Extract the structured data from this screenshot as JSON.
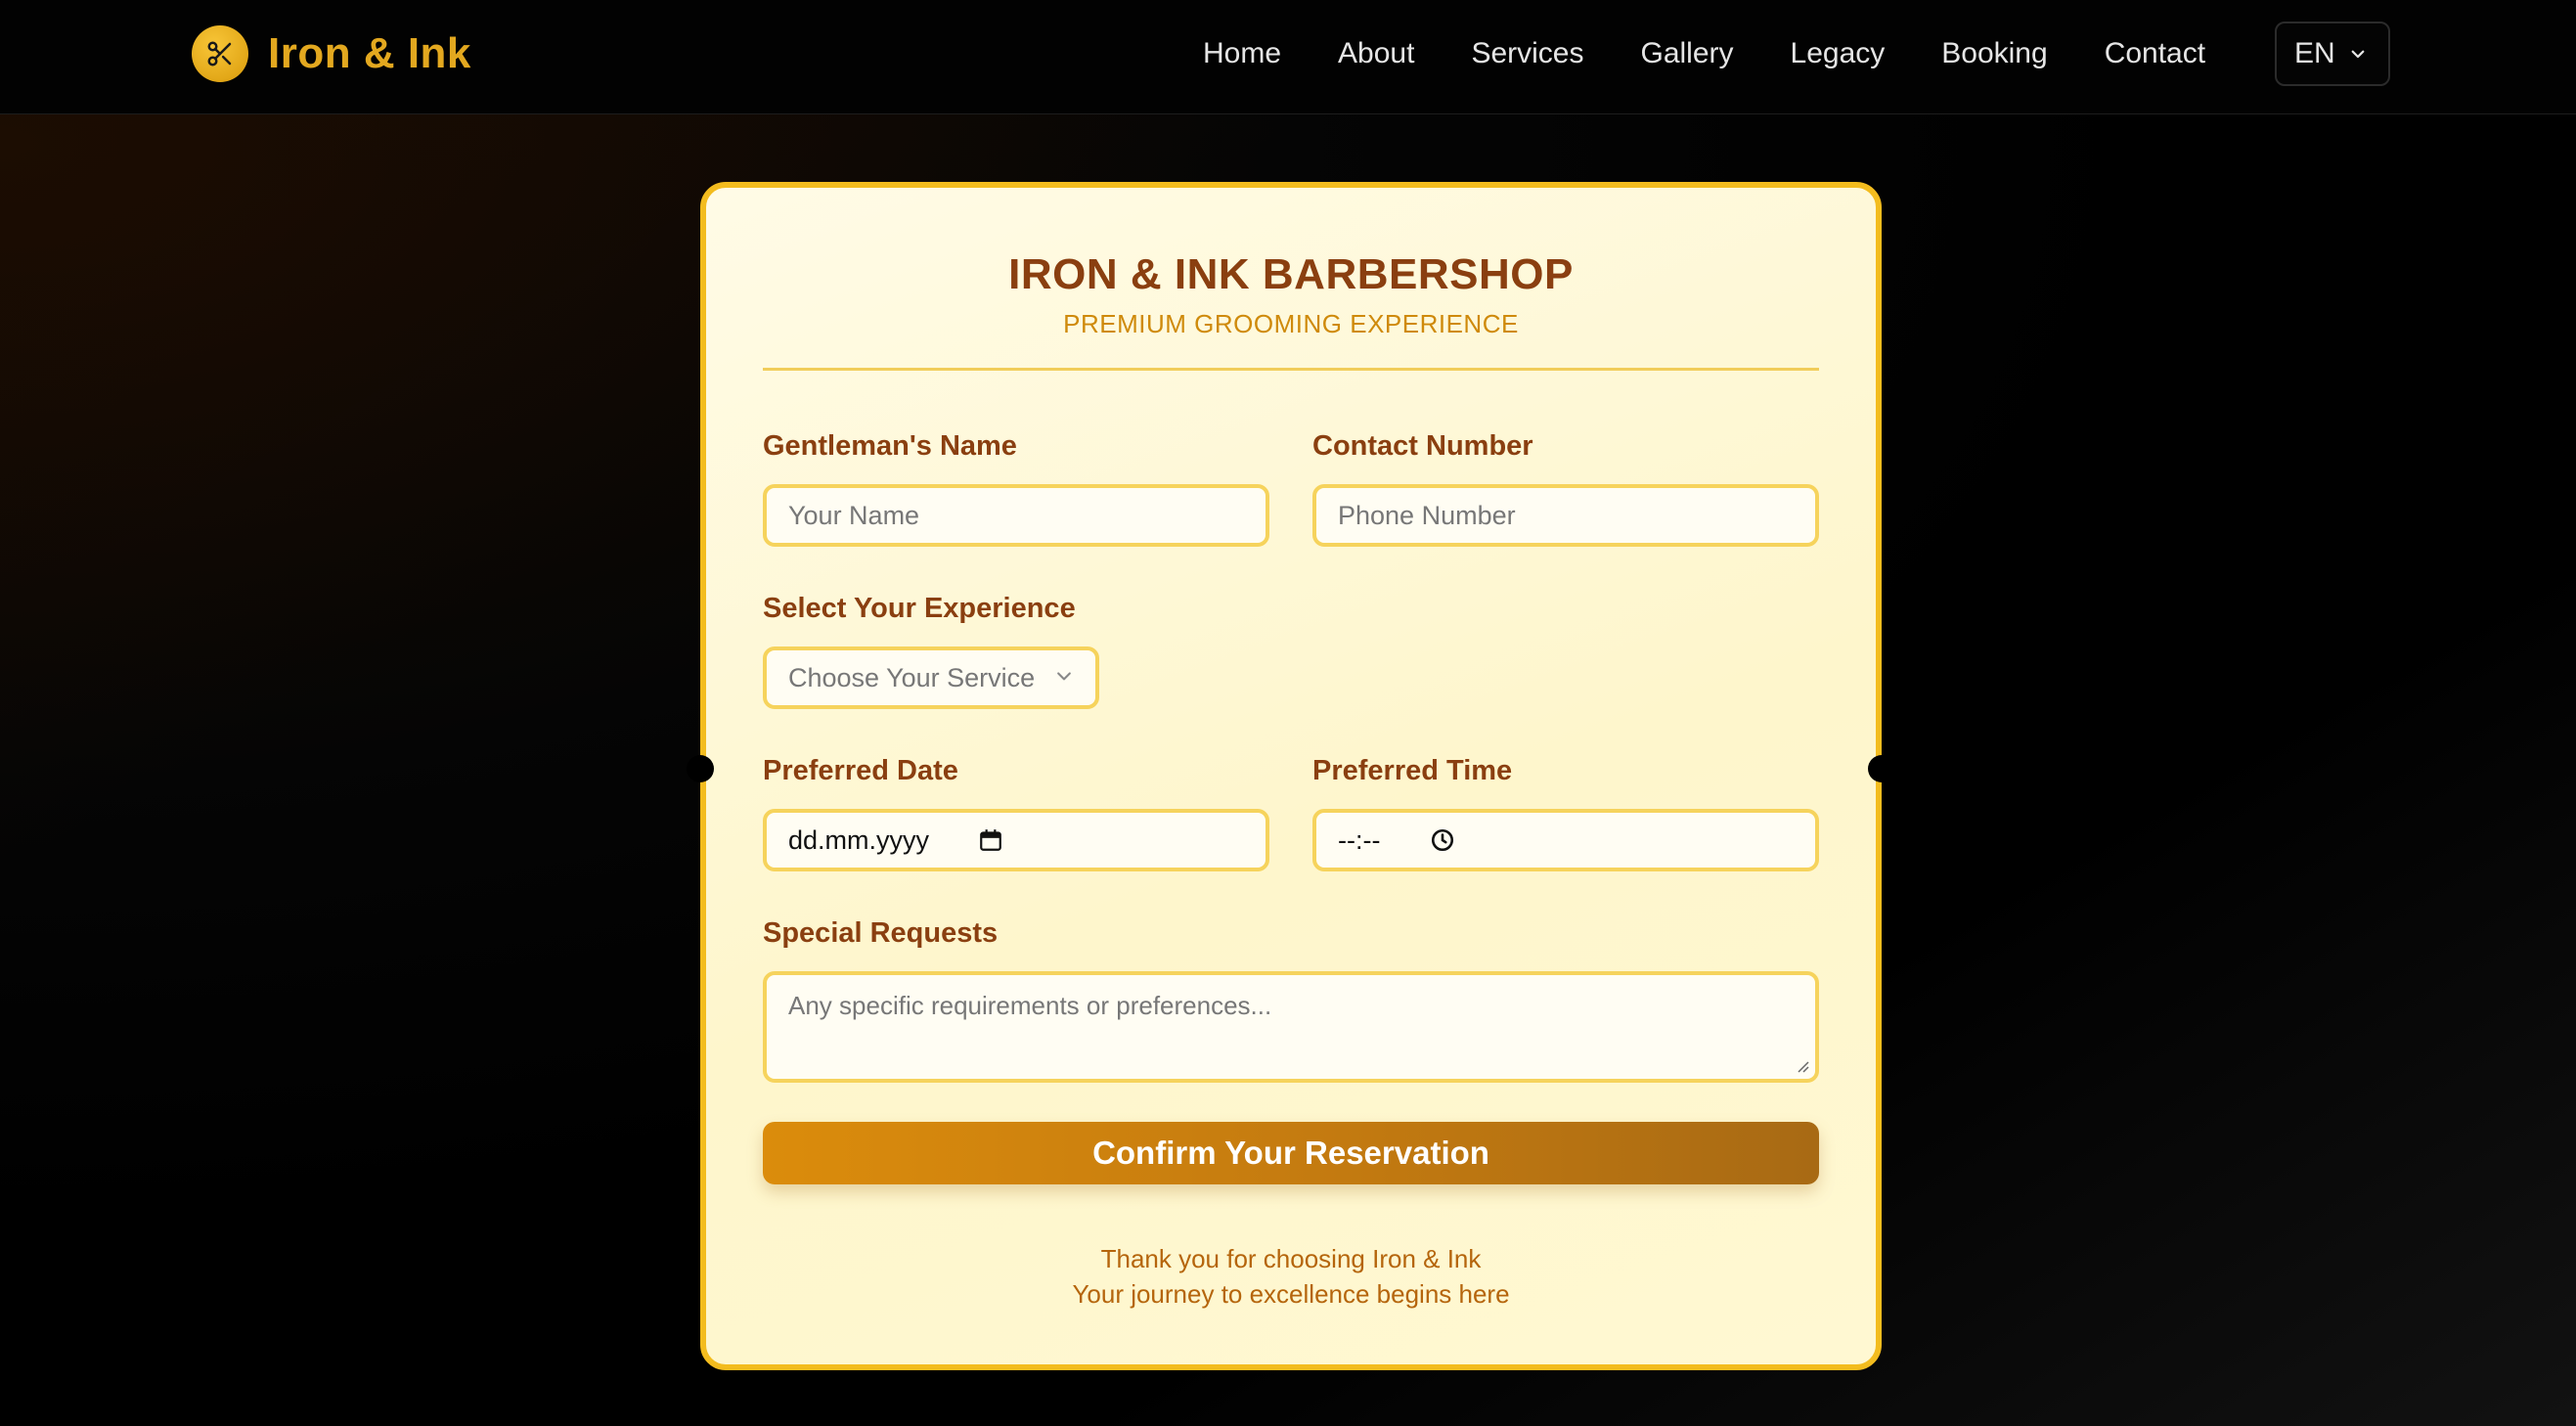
{
  "header": {
    "brand_name": "Iron & Ink",
    "logo_icon": "scissors-icon",
    "nav": [
      "Home",
      "About",
      "Services",
      "Gallery",
      "Legacy",
      "Booking",
      "Contact"
    ],
    "language": "EN"
  },
  "form": {
    "title": "IRON & INK BARBERSHOP",
    "subtitle": "PREMIUM GROOMING EXPERIENCE",
    "name_label": "Gentleman's Name",
    "name_placeholder": "Your Name",
    "phone_label": "Contact Number",
    "phone_placeholder": "Phone Number",
    "service_label": "Select Your Experience",
    "service_selected": "Choose Your Service",
    "date_label": "Preferred Date",
    "date_value": "dd.mm.yyyy",
    "time_label": "Preferred Time",
    "time_value": "--:--",
    "requests_label": "Special Requests",
    "requests_placeholder": "Any specific requirements or preferences...",
    "submit_label": "Confirm Your Reservation",
    "thanks_line1": "Thank you for choosing Iron & Ink",
    "thanks_line2": "Your journey to excellence begins here"
  },
  "colors": {
    "accent_gold": "#f3bc1e",
    "heading_brown": "#8a3f10",
    "button_orange": "#db8c0c"
  }
}
